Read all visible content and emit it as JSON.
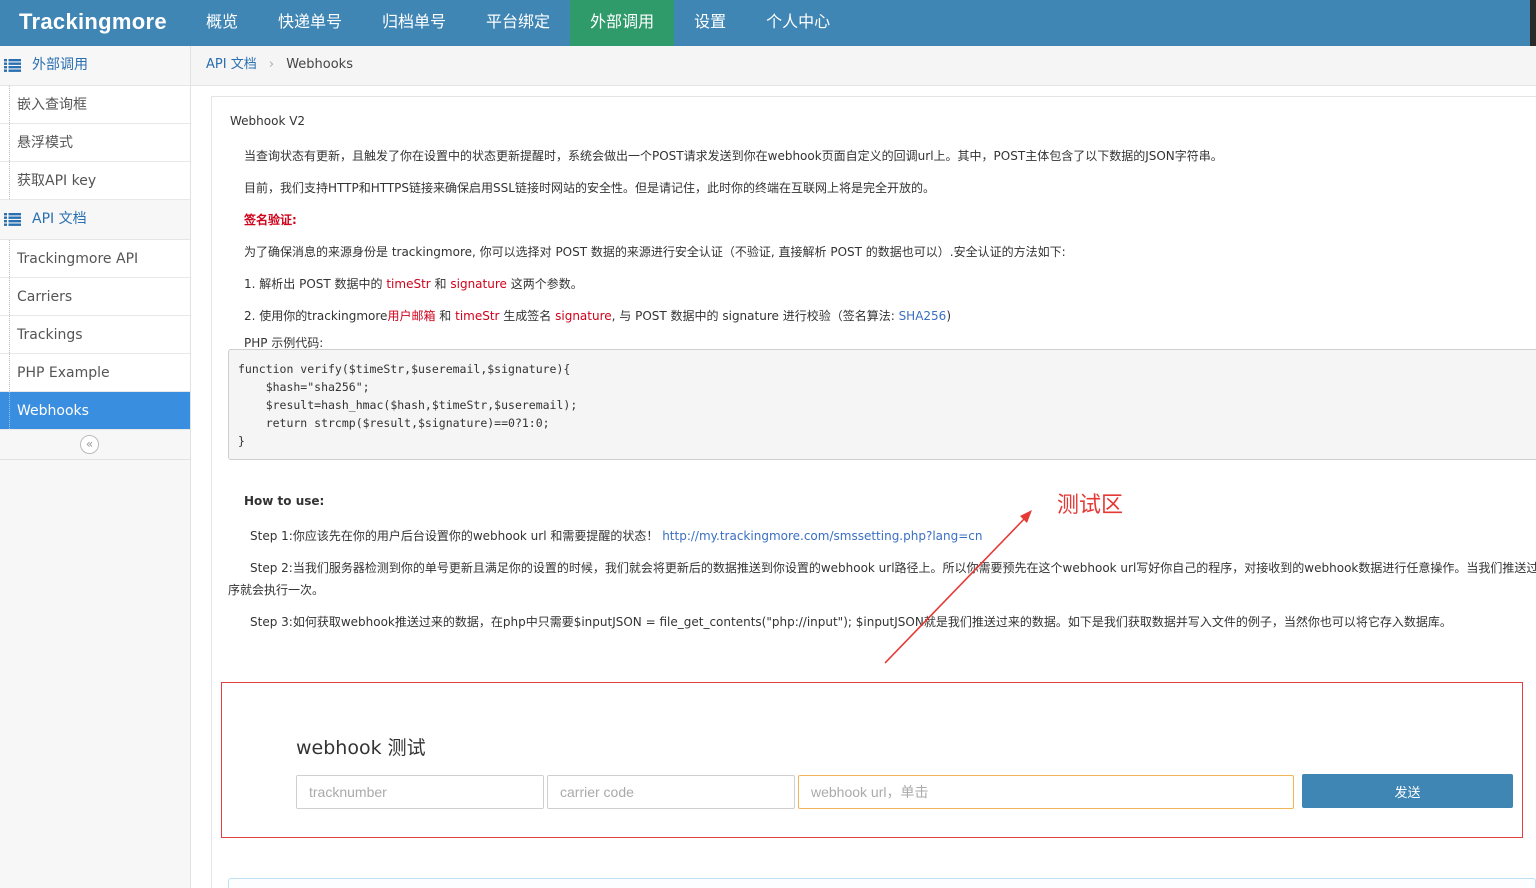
{
  "header": {
    "logo": "Trackingmore",
    "nav": [
      "概览",
      "快递单号",
      "归档单号",
      "平台绑定",
      "外部调用",
      "设置",
      "个人中心"
    ],
    "active_nav": "外部调用"
  },
  "sidebar": {
    "section1": {
      "label": "外部调用",
      "items": [
        "嵌入查询框",
        "悬浮模式",
        "获取API key"
      ]
    },
    "section2": {
      "label": "API 文档",
      "items": [
        "Trackingmore API",
        "Carriers",
        "Trackings",
        "PHP Example",
        "Webhooks"
      ]
    },
    "active_item": "Webhooks",
    "collapse_glyph": "«"
  },
  "breadcrumb": {
    "parent": "API 文档",
    "separator": "›",
    "current": "Webhooks"
  },
  "doc": {
    "title": "Webhook V2",
    "p1": "当查询状态有更新，且触发了你在设置中的状态更新提醒时，系统会做出一个POST请求发送到你在webhook页面自定义的回调url上。其中，POST主体包含了以下数据的JSON字符串。",
    "p2": "目前，我们支持HTTP和HTTPS链接来确保启用SSL链接时网站的安全性。但是请记住，此时你的终端在互联网上将是完全开放的。",
    "sign_heading": "签名验证:",
    "p3": "为了确保消息的来源身份是 trackingmore, 你可以选择对 POST 数据的来源进行安全认证（不验证, 直接解析 POST 的数据也可以）.安全认证的方法如下:",
    "s1_a": "1. 解析出 POST 数据中的 ",
    "s1_b": "timeStr",
    "s1_c": " 和 ",
    "s1_d": "signature",
    "s1_e": " 这两个参数。",
    "s2_a": "2. 使用你的trackingmore",
    "s2_b": "用户邮箱",
    "s2_c": " 和 ",
    "s2_d": "timeStr",
    "s2_e": " 生成签名 ",
    "s2_f": "signature",
    "s2_g": ", 与 POST 数据中的 signature 进行校验（签名算法: ",
    "s2_h": "SHA256",
    "s2_i": ")",
    "php_label": "PHP 示例代码:",
    "code_lines": [
      "function verify($timeStr,$useremail,$signature){",
      "    $hash=\"sha256\";",
      "    $result=hash_hmac($hash,$timeStr,$useremail);",
      "    return strcmp($result,$signature)==0?1:0;",
      "}"
    ],
    "howto": "How to use:",
    "step1_text": "Step 1:你应该先在你的用户后台设置你的webhook url 和需要提醒的状态！ ",
    "step1_link": "http://my.trackingmore.com/smssetting.php?lang=cn",
    "step2_line1": "Step 2:当我们服务器检测到你的单号更新且满足你的设置的时候，我们就会将更新后的数据推送到你设置的webhook url路径上。所以你需要预先在这个webhook url写好你自己的程序，对接收到的webhook数据进行任意操作。当我们推送过来的",
    "step2_line2": "序就会执行一次。",
    "step3": "Step 3:如何获取webhook推送过来的数据，在php中只需要$inputJSON = file_get_contents(\"php://input\"); $inputJSON就是我们推送过来的数据。如下是我们获取数据并写入文件的例子，当然你也可以将它存入数据库。"
  },
  "annotation": {
    "label": "测试区",
    "color": "#e53935"
  },
  "test": {
    "title": "webhook 测试",
    "tracknumber_placeholder": "tracknumber",
    "carrier_placeholder": "carrier code",
    "url_placeholder": "webhook url，单击",
    "send_label": "发送"
  }
}
